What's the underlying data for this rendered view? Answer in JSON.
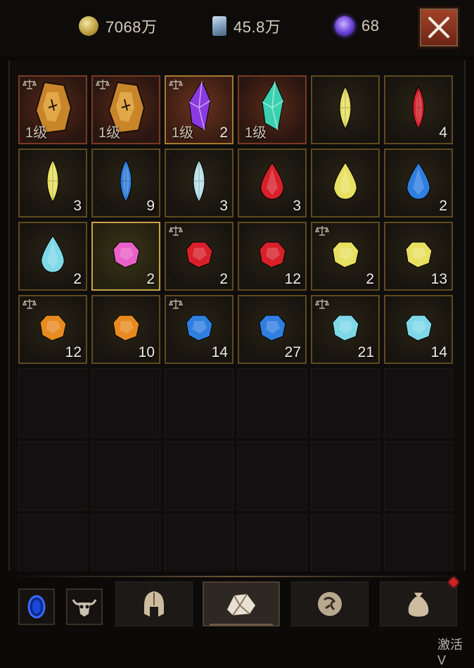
{
  "currencies": [
    {
      "icon": "gold-coin-icon",
      "value": "7068万"
    },
    {
      "icon": "scroll-icon",
      "value": "45.8万"
    },
    {
      "icon": "purple-orb-icon",
      "value": "68"
    }
  ],
  "close_label": "close",
  "inventory": {
    "rows": [
      [
        {
          "gem": "rune-stone-blue",
          "level": "1级",
          "count": "",
          "tradable": true,
          "style": "rare"
        },
        {
          "gem": "rune-stone-amber",
          "level": "1级",
          "count": "",
          "tradable": true,
          "style": "rare"
        },
        {
          "gem": "crystal-purple",
          "level": "1级",
          "count": "2",
          "tradable": true,
          "style": "selected"
        },
        {
          "gem": "crystal-teal",
          "level": "1级",
          "count": "",
          "tradable": false,
          "style": "rare"
        },
        {
          "gem": "marquise-yellow",
          "level": "",
          "count": "",
          "tradable": false,
          "style": "filled"
        },
        {
          "gem": "marquise-red",
          "level": "",
          "count": "4",
          "tradable": false,
          "style": "filled"
        }
      ],
      [
        {
          "gem": "marquise-yellow",
          "level": "",
          "count": "3",
          "tradable": false,
          "style": "filled"
        },
        {
          "gem": "marquise-blue",
          "level": "",
          "count": "9",
          "tradable": false,
          "style": "filled"
        },
        {
          "gem": "marquise-white",
          "level": "",
          "count": "3",
          "tradable": false,
          "style": "filled"
        },
        {
          "gem": "teardrop-red",
          "level": "",
          "count": "3",
          "tradable": false,
          "style": "filled"
        },
        {
          "gem": "teardrop-yellow",
          "level": "",
          "count": "",
          "tradable": false,
          "style": "filled"
        },
        {
          "gem": "teardrop-blue",
          "level": "",
          "count": "2",
          "tradable": false,
          "style": "filled"
        }
      ],
      [
        {
          "gem": "teardrop-cyan",
          "level": "",
          "count": "2",
          "tradable": false,
          "style": "filled"
        },
        {
          "gem": "round-pink",
          "level": "",
          "count": "2",
          "tradable": false,
          "style": "highlight"
        },
        {
          "gem": "round-red",
          "level": "",
          "count": "2",
          "tradable": true,
          "style": "filled"
        },
        {
          "gem": "round-red",
          "level": "",
          "count": "12",
          "tradable": false,
          "style": "filled"
        },
        {
          "gem": "round-yellow",
          "level": "",
          "count": "2",
          "tradable": true,
          "style": "filled"
        },
        {
          "gem": "round-yellow",
          "level": "",
          "count": "13",
          "tradable": false,
          "style": "filled"
        }
      ],
      [
        {
          "gem": "round-orange",
          "level": "",
          "count": "12",
          "tradable": true,
          "style": "filled"
        },
        {
          "gem": "round-orange",
          "level": "",
          "count": "10",
          "tradable": false,
          "style": "filled"
        },
        {
          "gem": "round-blue",
          "level": "",
          "count": "14",
          "tradable": true,
          "style": "filled"
        },
        {
          "gem": "round-blue",
          "level": "",
          "count": "27",
          "tradable": false,
          "style": "filled"
        },
        {
          "gem": "round-cyan",
          "level": "",
          "count": "21",
          "tradable": true,
          "style": "filled"
        },
        {
          "gem": "round-cyan",
          "level": "",
          "count": "14",
          "tradable": false,
          "style": "filled"
        }
      ]
    ],
    "empty_rows": 3,
    "columns": 6
  },
  "bottom": {
    "buttons": [
      {
        "icon": "blue-portal-icon"
      },
      {
        "icon": "bull-skull-icon"
      }
    ],
    "tabs": [
      {
        "icon": "helmet-icon",
        "active": false
      },
      {
        "icon": "gem-stone-icon",
        "active": true
      },
      {
        "icon": "rune-icon",
        "active": false
      },
      {
        "icon": "sack-icon",
        "active": false
      }
    ],
    "watermark": "激活 V"
  },
  "colors": {
    "red": "#d8202a",
    "yellow": "#e8e060",
    "blue": "#2f7fe0",
    "white": "#b8e0e8",
    "cyan": "#7fd8e8",
    "pink": "#e860c8",
    "orange": "#e88a20",
    "purple": "#8a3ae0",
    "teal": "#3ad0b0"
  }
}
